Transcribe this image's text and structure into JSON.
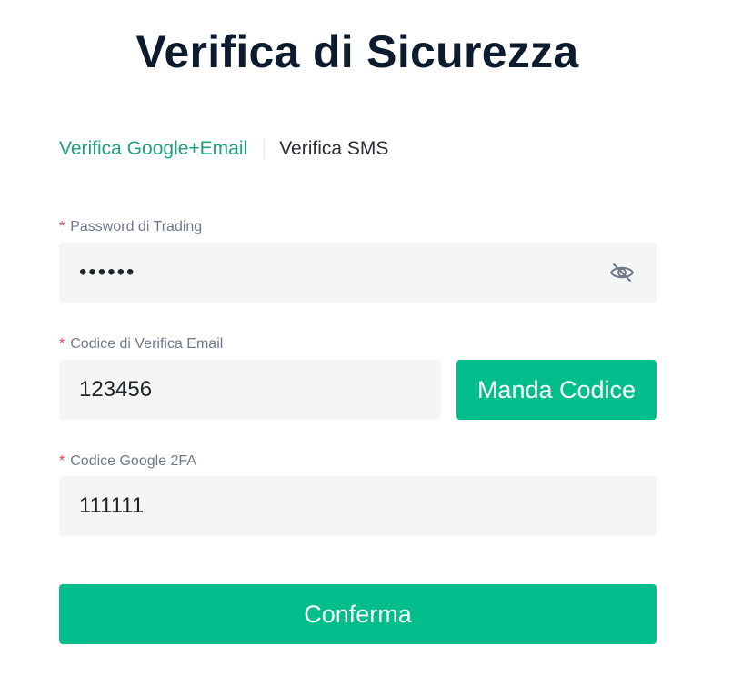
{
  "page_title": "Verifica di Sicurezza",
  "tabs": [
    {
      "label": "Verifica Google+Email",
      "active": true
    },
    {
      "label": "Verifica SMS",
      "active": false
    }
  ],
  "form": {
    "required_marker": "*",
    "trading_password": {
      "label": "Password di Trading",
      "value": "••••••",
      "toggle_icon": "eye-off-icon"
    },
    "email_code": {
      "label": "Codice di Verifica Email",
      "value": "123456",
      "send_button": "Manda Codice"
    },
    "google_2fa": {
      "label": "Codice Google 2FA",
      "value": "111111"
    },
    "submit_button": "Conferma"
  },
  "colors": {
    "accent": "#02bd8c",
    "active_tab": "#21a07d",
    "required": "#e8424b",
    "input_bg": "#f4f5f5",
    "title": "#0c1c2e"
  }
}
